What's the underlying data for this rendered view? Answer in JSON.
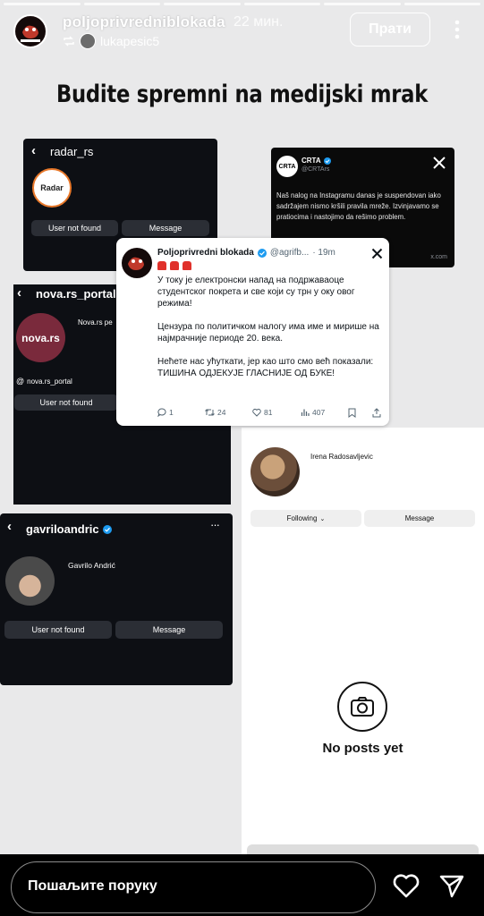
{
  "header": {
    "username": "poljoprivredniblokada",
    "time": "22 мин.",
    "reposted_from": "lukapesic5",
    "follow_label": "Прати",
    "progress_segments": 6
  },
  "story": {
    "title": "Budite spremni na medijski mrak"
  },
  "card_radar": {
    "username": "radar_rs",
    "logo_text": "Radar",
    "btn_left": "User not found",
    "btn_right": "Message"
  },
  "card_crta": {
    "logo_text": "CRTA",
    "display_name": "CRTA",
    "handle": "@CRTArs",
    "body": "Naš nalog na Instagramu danas je suspendovan iako sadržajem nismo kršili pravila mreže. Izvinjavamo se pratiocima i nastojimo da rešimo problem.",
    "footer": "x.com"
  },
  "card_nova": {
    "username": "nova.rs_portal",
    "logo_text": "nova.rs",
    "display_name": "Nova.rs pe",
    "threads_handle": "nova.rs_portal",
    "btn_left": "User not found"
  },
  "tweet": {
    "author": "Poljoprivredni blokada",
    "handle": "@agrifb...",
    "time": "· 19m",
    "para1": "У току је електронски напад на подржаваоце студентског покрета и све који су трн у оку овог режима!",
    "para2": "Цензура по политичком налогу има име и мирише на најмрачније периоде 20. века.",
    "para3": "Нећете нас ућуткати, јер као што смо већ показали: ТИШИНА ОДЈЕКУЈЕ ГЛАСНИЈЕ ОД БУКЕ!",
    "replies": "1",
    "retweets": "24",
    "likes": "81",
    "views": "407"
  },
  "card_irena": {
    "display_name": "Irena Radosavljevic",
    "btn_left": "Following",
    "btn_right": "Message",
    "empty_text": "No posts yet"
  },
  "card_gavrilo": {
    "username": "gavriloandric",
    "display_name": "Gavrilo Andrić",
    "btn_left": "User not found",
    "btn_right": "Message"
  },
  "bottom": {
    "reply_placeholder": "Пошаљите поруку"
  },
  "colors": {
    "story_bg": "#e9e9ea",
    "card_dark": "#0d0f14",
    "verified": "#1d9bf0",
    "nova_red": "#7a2a3c",
    "radar_orange": "#e8782a"
  }
}
